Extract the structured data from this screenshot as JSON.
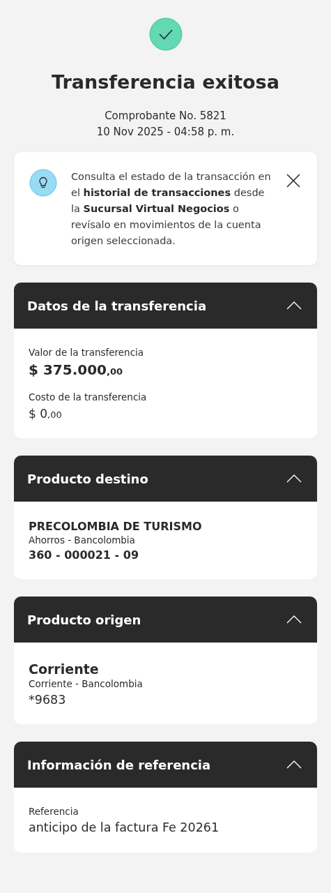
{
  "status": {
    "kind": "success",
    "title": "Transferencia exitosa",
    "receipt": "Comprobante No. 5821",
    "datetime": "10 Nov 2025 - 04:58 p. m."
  },
  "tip": {
    "text": "Consulta el estado de la transacción en el **historial de transacciones** desde la **Sucursal Virtual Negocios** o revísalo en movimientos de la cuenta origen seleccionada."
  },
  "sections": [
    {
      "title": "Datos de la transferencia",
      "expanded": true,
      "lines": [
        {
          "kind": "label",
          "text": "Valor de la transferencia"
        },
        {
          "kind": "amount_large",
          "text": "$ 375.000",
          "cents": ",00"
        },
        {
          "kind": "label",
          "text": "Costo de la transferencia"
        },
        {
          "kind": "amount",
          "text": "$ 0",
          "cents": ",00"
        }
      ]
    },
    {
      "title": "Producto destino",
      "expanded": true,
      "lines": [
        {
          "kind": "name",
          "text": "PRECOLOMBIA DE TURISMO"
        },
        {
          "kind": "detail",
          "text": "Ahorros - Bancolombia"
        },
        {
          "kind": "number",
          "text": "360 - 000021 - 09"
        }
      ]
    },
    {
      "title": "Producto origen",
      "expanded": true,
      "lines": [
        {
          "kind": "heading",
          "text": "Corriente"
        },
        {
          "kind": "detail",
          "text": "Corriente - Bancolombia"
        },
        {
          "kind": "value",
          "text": "*9683"
        }
      ]
    },
    {
      "title": "Información de referencia",
      "expanded": true,
      "lines": [
        {
          "kind": "label",
          "text": "Referencia"
        },
        {
          "kind": "value",
          "text": "anticipo de la factura Fe 20261"
        }
      ]
    }
  ]
}
